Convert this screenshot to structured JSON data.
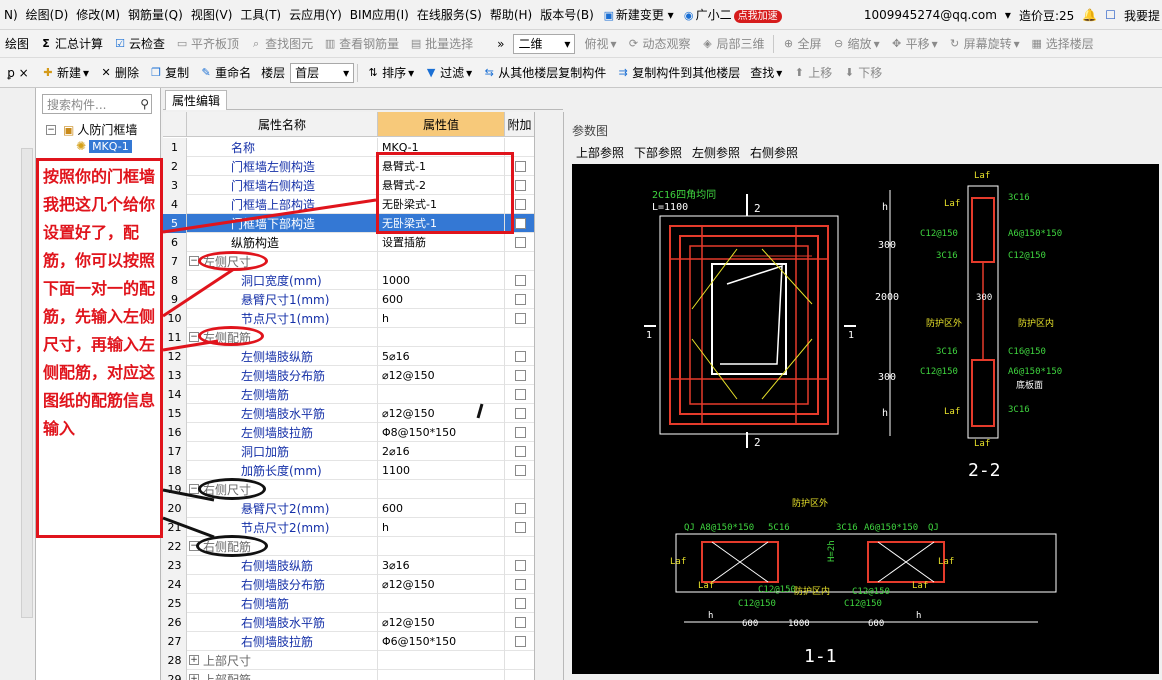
{
  "menu": {
    "items": [
      "N)",
      "绘图(D)",
      "修改(M)",
      "钢筋量(Q)",
      "视图(V)",
      "工具(T)",
      "云应用(Y)",
      "BIM应用(I)",
      "在线服务(S)",
      "帮助(H)",
      "版本号(B)",
      "新建变更",
      "广小二"
    ],
    "speed_badge": "点我加速",
    "account": "1009945274@qq.com",
    "coins": "造价豆:25",
    "help_link": "我要提"
  },
  "toolbar1": {
    "items": [
      "绘图",
      "汇总计算",
      "云检查",
      "平齐板顶",
      "查找图元",
      "查看钢筋量",
      "批量选择"
    ],
    "view_combo": "二维",
    "view_items": [
      "俯视",
      "动态观察",
      "局部三维",
      "全屏",
      "缩放",
      "平移",
      "屏幕旋转",
      "选择楼层"
    ]
  },
  "toolbar2": {
    "items": [
      "新建",
      "删除",
      "复制",
      "重命名"
    ],
    "floor_label": "楼层",
    "floor_value": "首层",
    "more": [
      "排序",
      "过滤",
      "从其他楼层复制构件",
      "复制构件到其他楼层",
      "查找",
      "上移",
      "下移"
    ]
  },
  "tree": {
    "search_placeholder": "搜索构件...",
    "root": "人防门框墙",
    "child": "MKQ-1"
  },
  "annotation": "按照你的门框墙我把这几个给你设置好了，配筋，你可以按照下面一对一的配筋，先输入左侧尺寸，再输入左侧配筋，对应这图纸的配筋信息输入",
  "prop": {
    "tab": "属性编辑",
    "col_name": "属性名称",
    "col_value": "属性值",
    "col_extra": "附加",
    "rows": [
      {
        "n": "1",
        "name": "名称",
        "value": "MKQ-1"
      },
      {
        "n": "2",
        "name": "门框墙左侧构造",
        "value": "悬臂式-1"
      },
      {
        "n": "3",
        "name": "门框墙右侧构造",
        "value": "悬臂式-2"
      },
      {
        "n": "4",
        "name": "门框墙上部构造",
        "value": "无卧梁式-1"
      },
      {
        "n": "5",
        "name": "门框墙下部构造",
        "value": "无卧梁式-1"
      },
      {
        "n": "6",
        "name": "纵筋构造",
        "value": "设置插筋"
      },
      {
        "n": "7",
        "name": "左侧尺寸",
        "value": ""
      },
      {
        "n": "8",
        "name": "洞口宽度(mm)",
        "value": "1000"
      },
      {
        "n": "9",
        "name": "悬臂尺寸1(mm)",
        "value": "600"
      },
      {
        "n": "10",
        "name": "节点尺寸1(mm)",
        "value": "h"
      },
      {
        "n": "11",
        "name": "左侧配筋",
        "value": ""
      },
      {
        "n": "12",
        "name": "左侧墙肢纵筋",
        "value": "5⌀16"
      },
      {
        "n": "13",
        "name": "左侧墙肢分布筋",
        "value": "⌀12@150"
      },
      {
        "n": "14",
        "name": "左侧墙筋",
        "value": ""
      },
      {
        "n": "15",
        "name": "左侧墙肢水平筋",
        "value": "⌀12@150"
      },
      {
        "n": "16",
        "name": "左侧墙肢拉筋",
        "value": "Φ8@150*150"
      },
      {
        "n": "17",
        "name": "洞口加筋",
        "value": "2⌀16"
      },
      {
        "n": "18",
        "name": "加筋长度(mm)",
        "value": "1100"
      },
      {
        "n": "19",
        "name": "右侧尺寸",
        "value": ""
      },
      {
        "n": "20",
        "name": "悬臂尺寸2(mm)",
        "value": "600"
      },
      {
        "n": "21",
        "name": "节点尺寸2(mm)",
        "value": "h"
      },
      {
        "n": "22",
        "name": "右侧配筋",
        "value": ""
      },
      {
        "n": "23",
        "name": "右侧墙肢纵筋",
        "value": "3⌀16"
      },
      {
        "n": "24",
        "name": "右侧墙肢分布筋",
        "value": "⌀12@150"
      },
      {
        "n": "25",
        "name": "右侧墙筋",
        "value": ""
      },
      {
        "n": "26",
        "name": "右侧墙肢水平筋",
        "value": "⌀12@150"
      },
      {
        "n": "27",
        "name": "右侧墙肢拉筋",
        "value": "Φ6@150*150"
      },
      {
        "n": "28",
        "name": "上部尺寸",
        "value": ""
      },
      {
        "n": "29",
        "name": "上部配筋",
        "value": ""
      }
    ]
  },
  "param": {
    "title": "参数图",
    "refs": [
      "上部参照",
      "下部参照",
      "左侧参照",
      "右侧参照"
    ],
    "drawing": {
      "corner_bar": "2C16四角均同",
      "corner_len": "L=1100",
      "sec2": "2",
      "sec1": "1",
      "dims_v": [
        "h",
        "300",
        "2000",
        "300",
        "h"
      ],
      "dims_v2": [
        "300",
        "300"
      ],
      "laf": "Laf",
      "right_labels": [
        "3C16",
        "C12@150",
        "A6@150*150",
        "3C16",
        "C12@150",
        "C16@150",
        "3C16",
        "C12@150",
        "A6@150*150",
        "3C16"
      ],
      "zone_out": "防护区外",
      "zone_in": "防护区内",
      "floor": "底板面",
      "title22": "2-2",
      "bottom_top": "防护区外",
      "bottom_labels": [
        "QJ",
        "A8@150*150",
        "5C16",
        "3C16",
        "A6@150*150",
        "QJ"
      ],
      "bottom_mid": "C12@150",
      "bottom_in": "防护区内",
      "dims_h": [
        "h",
        "600",
        "1000",
        "600",
        "h"
      ],
      "h_label": "H=2h",
      "title11": "1-1"
    }
  }
}
